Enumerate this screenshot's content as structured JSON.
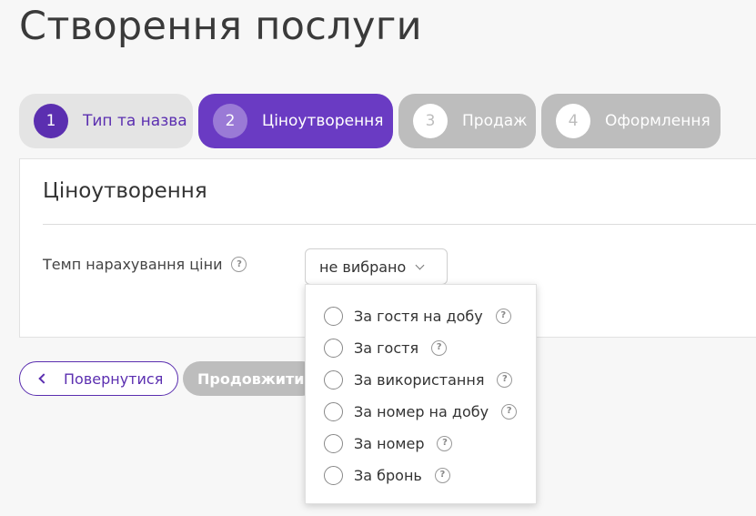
{
  "page": {
    "title": "Створення послуги"
  },
  "steps": [
    {
      "number": "1",
      "label": "Тип та назва",
      "state": "done"
    },
    {
      "number": "2",
      "label": "Ціноутворення",
      "state": "active"
    },
    {
      "number": "3",
      "label": "Продаж",
      "state": "todo"
    },
    {
      "number": "4",
      "label": "Оформлення",
      "state": "todo"
    }
  ],
  "panel": {
    "title": "Ціноутворення",
    "field_label": "Темп нарахування ціни",
    "select_value": "не вибрано"
  },
  "dropdown": {
    "options": [
      {
        "label": "За гостя на добу"
      },
      {
        "label": "За гостя"
      },
      {
        "label": "За використання"
      },
      {
        "label": "За номер на добу"
      },
      {
        "label": "За номер"
      },
      {
        "label": "За бронь"
      }
    ]
  },
  "actions": {
    "back_label": "Повернутися",
    "next_label": "Продовжити"
  },
  "icons": {
    "help": "question-circle-icon",
    "select_chevron": "chevron-down-icon",
    "back_chevron": "chevron-left-icon"
  },
  "colors": {
    "accent": "#5b2fb0",
    "active_step": "#6a3bc3",
    "disabled": "#bdbdbd"
  }
}
